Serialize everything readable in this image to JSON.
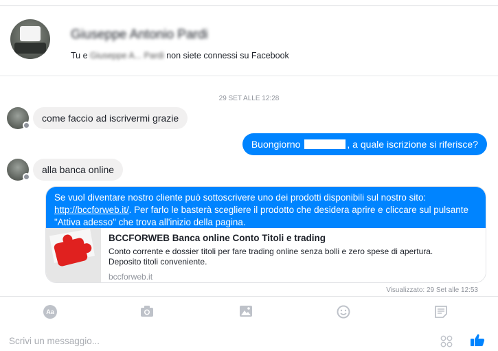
{
  "header": {
    "contact_name": "Giuseppe Antonio Pardi",
    "status_prefix": "Tu e ",
    "status_name_redacted": "Giuseppe A... Pardi",
    "status_suffix": " non siete connessi su Facebook"
  },
  "conversation": {
    "timestamp": "29 SET ALLE 12:28",
    "messages": [
      {
        "from": "contact",
        "text": "come faccio ad iscrivermi grazie"
      },
      {
        "from": "page",
        "text_before": "Buongiorno ",
        "text_after": ", a quale iscrizione si riferisce?"
      },
      {
        "from": "contact",
        "text": "alla banca online"
      }
    ],
    "card": {
      "text_before": "Se vuol diventare nostro cliente può sottoscrivere uno dei prodotti disponibili sul nostro sito:",
      "link": "http://bccforweb.it/",
      "text_after": ". Per farlo le basterà scegliere il prodotto che desidera aprire e cliccare sul pulsante \"Attiva adesso\" che trova all'inizio della pagina.",
      "preview": {
        "title": "BCCFORWEB Banca online Conto Titoli e trading",
        "description": "Conto corrente e dossier titoli per fare trading online senza bolli e zero spese di apertura. Deposito titoli conveniente.",
        "domain": "bccforweb.it"
      }
    },
    "seen_receipt": "Visualizzato: 29 Set alle 12:53"
  },
  "toolbar": {
    "aa_label": "Aa",
    "icons": [
      "text-format-icon",
      "camera-icon",
      "image-icon",
      "emoji-icon",
      "sticker-icon"
    ]
  },
  "composer": {
    "placeholder": "Scrivi un messaggio...",
    "icons": [
      "apps-icon",
      "thumbs-up-icon"
    ]
  },
  "colors": {
    "accent": "#0084ff",
    "incoming_bubble": "#f1f0f0",
    "muted_text": "#90949c"
  }
}
